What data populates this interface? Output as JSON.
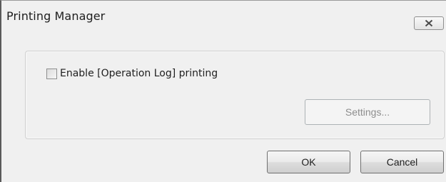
{
  "window": {
    "title": "Printing Manager",
    "close_icon": "close-icon"
  },
  "options": {
    "enable_operation_log_label": "Enable [Operation Log] printing",
    "enable_operation_log_checked": false
  },
  "buttons": {
    "settings_label": "Settings...",
    "settings_enabled": false,
    "ok_label": "OK",
    "cancel_label": "Cancel"
  }
}
